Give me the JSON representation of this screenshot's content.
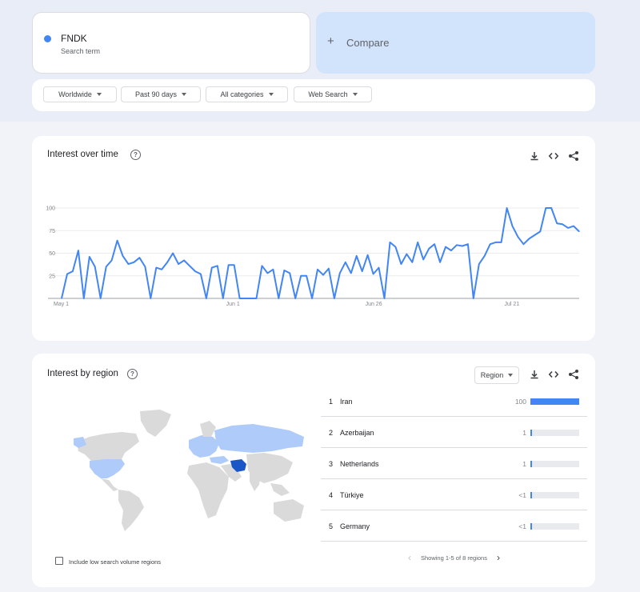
{
  "search_term": {
    "name": "FNDK",
    "subtitle": "Search term",
    "color": "#4285f4"
  },
  "compare": {
    "plus": "+",
    "label": "Compare"
  },
  "filters": [
    "Worldwide",
    "Past 90 days",
    "All categories",
    "Web Search"
  ],
  "interest_over_time": {
    "title": "Interest over time",
    "help": "?",
    "icons": [
      "download-icon",
      "embed-icon",
      "share-icon"
    ]
  },
  "chart_data": {
    "type": "line",
    "title": "Interest over time",
    "ylim": [
      0,
      100
    ],
    "yticks": [
      25,
      50,
      75,
      100
    ],
    "xticks": [
      {
        "label": "May 1",
        "index": 0
      },
      {
        "label": "Jun 1",
        "index": 31
      },
      {
        "label": "Jun 26",
        "index": 56
      },
      {
        "label": "Jul 21",
        "index": 81
      }
    ],
    "grid": true,
    "line_color": "#4285f4",
    "values": [
      0,
      27,
      30,
      53,
      0,
      46,
      35,
      0,
      35,
      42,
      64,
      47,
      38,
      40,
      45,
      35,
      0,
      34,
      32,
      40,
      50,
      38,
      42,
      36,
      30,
      27,
      0,
      34,
      36,
      0,
      37,
      37,
      0,
      0,
      0,
      0,
      36,
      28,
      32,
      0,
      31,
      28,
      0,
      25,
      25,
      0,
      32,
      26,
      33,
      0,
      28,
      40,
      28,
      47,
      30,
      48,
      27,
      34,
      0,
      62,
      57,
      38,
      49,
      40,
      62,
      43,
      55,
      60,
      40,
      57,
      53,
      59,
      58,
      60,
      0,
      38,
      47,
      60,
      62,
      62,
      100,
      80,
      68,
      60,
      66,
      70,
      74,
      100,
      100,
      83,
      82,
      78,
      80,
      74
    ]
  },
  "interest_by_region": {
    "title": "Interest by region",
    "help": "?",
    "select_label": "Region",
    "icons": [
      "download-icon",
      "embed-icon",
      "share-icon"
    ],
    "rows": [
      {
        "rank": "1",
        "name": "Iran",
        "value": "100",
        "fraction": 1.0
      },
      {
        "rank": "2",
        "name": "Azerbaijan",
        "value": "1",
        "fraction": 0.01
      },
      {
        "rank": "3",
        "name": "Netherlands",
        "value": "1",
        "fraction": 0.01
      },
      {
        "rank": "4",
        "name": "Türkiye",
        "value": "<1",
        "fraction": 0.005
      },
      {
        "rank": "5",
        "name": "Germany",
        "value": "<1",
        "fraction": 0.005
      }
    ],
    "pager": {
      "text": "Showing 1-5 of 8 regions",
      "prev": "‹",
      "next": "›"
    },
    "low_volume_label": "Include low search volume regions"
  }
}
